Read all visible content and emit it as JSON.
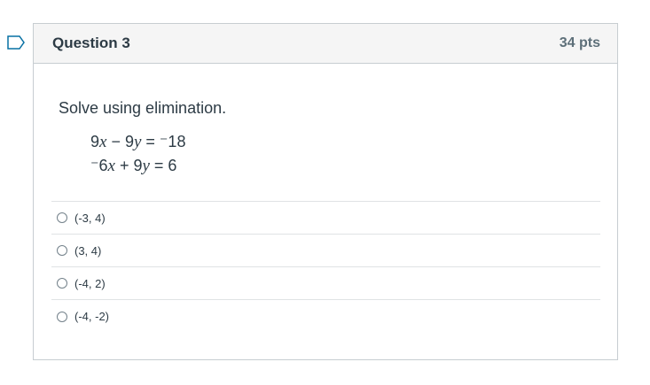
{
  "question": {
    "title": "Question 3",
    "points": "34 pts",
    "prompt": "Solve using elimination.",
    "equations": [
      {
        "a": "9",
        "v1": "x",
        "op": " − 9",
        "v2": "y",
        "rhs": " = ⁻18"
      },
      {
        "a": "⁻6",
        "v1": "x",
        "op": " + 9",
        "v2": "y",
        "rhs": " = 6"
      }
    ],
    "answers": [
      {
        "label": "(-3, 4)"
      },
      {
        "label": "(3, 4)"
      },
      {
        "label": "(-4, 2)"
      },
      {
        "label": "(-4, -2)"
      }
    ]
  },
  "colors": {
    "flag_outline": "#0770a3",
    "header_bg": "#f5f5f5",
    "border": "#c7cdd1"
  }
}
